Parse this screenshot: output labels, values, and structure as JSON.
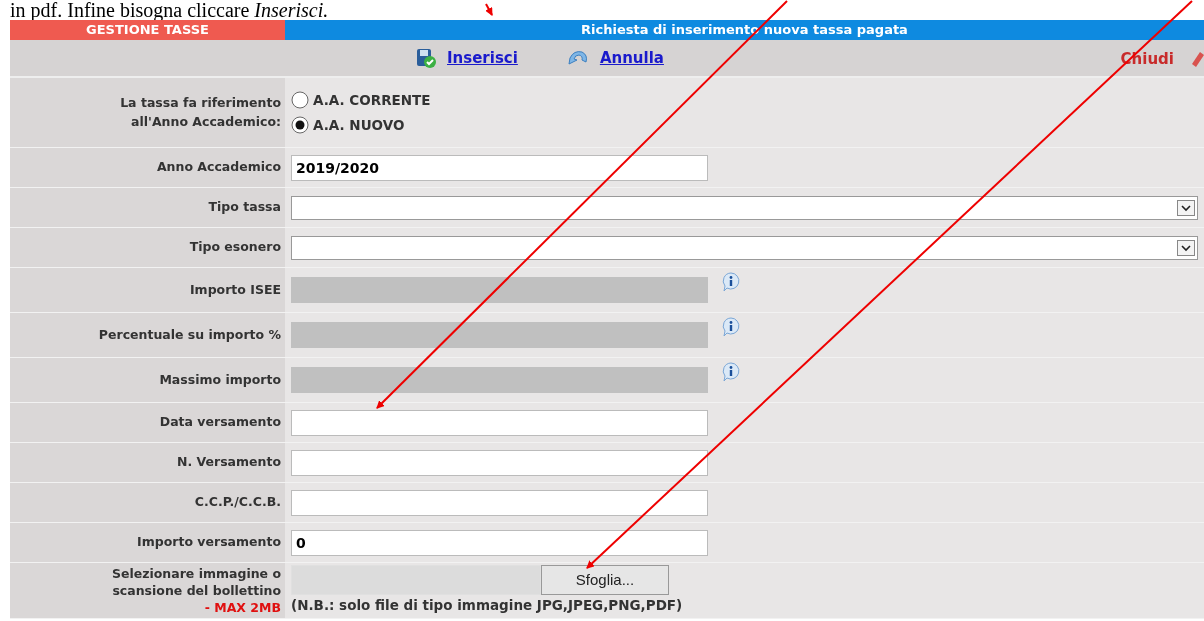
{
  "document_text": "in pdf. Infine bisogna cliccare *Inserisci.*",
  "header": {
    "section": "GESTIONE TASSE",
    "title": "Richiesta di inserimento nuova tassa pagata"
  },
  "toolbar": {
    "actions": [
      {
        "label": "Inserisci",
        "kind": "save"
      },
      {
        "label": "Annulla",
        "kind": "undo"
      }
    ],
    "close": "Chiudi"
  },
  "fields": [
    {
      "kind": "radio",
      "label": "La tassa fa riferimento all'Anno Accademico:",
      "options": [
        {
          "label": "A.A. CORRENTE",
          "selected": false
        },
        {
          "label": "A.A. NUOVO",
          "selected": true
        }
      ]
    },
    {
      "kind": "text",
      "label": "Anno Accademico",
      "value": "2019/2020"
    },
    {
      "kind": "select",
      "label": "Tipo tassa"
    },
    {
      "kind": "select",
      "label": "Tipo esonero"
    },
    {
      "kind": "disabled",
      "label": "Importo ISEE"
    },
    {
      "kind": "disabled",
      "label": "Percentuale su importo %"
    },
    {
      "kind": "disabled",
      "label": "Massimo importo"
    },
    {
      "kind": "text",
      "label": "Data versamento"
    },
    {
      "kind": "text",
      "label": "N. Versamento"
    },
    {
      "kind": "text",
      "label": "C.C.P./C.C.B."
    },
    {
      "kind": "text",
      "label": "Importo versamento",
      "value": "0"
    },
    {
      "kind": "file",
      "label": "Selezionare immagine o scansione del bollettino",
      "limit": "- MAX 2MB",
      "button": "Sfoglia...",
      "note": "(N.B.: solo file di tipo immagine JPG,JPEG,PNG,PDF)"
    }
  ]
}
